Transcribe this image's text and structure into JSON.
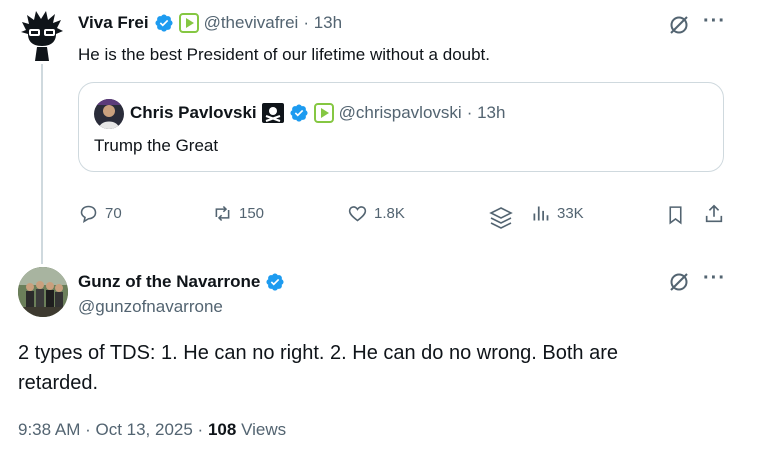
{
  "tweet1": {
    "author": "Viva Frei",
    "handle": "@thevivafrei",
    "time": "· 13h",
    "text": "He is the best President of our lifetime without a doubt.",
    "quote": {
      "author": "Chris Pavlovski",
      "handle": "@chrispavlovski",
      "time": "· 13h",
      "text": "Trump the Great"
    },
    "actions": {
      "replies": "70",
      "reposts": "150",
      "likes": "1.8K",
      "views": "33K"
    }
  },
  "tweet2": {
    "author": "Gunz of the Navarrone",
    "handle": "@gunzofnavarrone",
    "text": "2 types of TDS: 1. He can no right. 2. He can do no wrong.  Both are retarded.",
    "timestamp": "9:38 AM · Oct 13, 2025 ·",
    "views_count": "108",
    "views_label": "Views"
  },
  "colors": {
    "verified": "#1d9bf0",
    "rumble": "#85c742",
    "secondary_text": "#536471",
    "border": "#cfd9de"
  }
}
